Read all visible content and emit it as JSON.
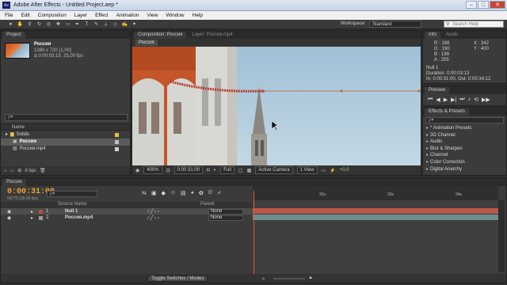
{
  "app": {
    "title": "Adobe After Effects - Untitled Project.aep *",
    "logo": "Ae"
  },
  "window_controls": {
    "minimize": "–",
    "maximize": "□",
    "close": "✕"
  },
  "menu": [
    "File",
    "Edit",
    "Composition",
    "Layer",
    "Effect",
    "Animation",
    "View",
    "Window",
    "Help"
  ],
  "toolbar": {
    "tools": [
      "selection-tool",
      "hand-tool",
      "zoom-tool",
      "rotate-tool",
      "camera-tool",
      "pan-behind-tool",
      "pen-tool",
      "type-tool",
      "brush-tool",
      "clone-stamp-tool",
      "eraser-tool",
      "roto-brush-tool",
      "puppet-tool"
    ],
    "workspace_label": "Workspace:",
    "workspace_value": "Standard",
    "search_placeholder": "Search Help"
  },
  "project": {
    "tab": "Project",
    "item_name": "Россия",
    "item_dims": "1280 x 720 (1,00)",
    "item_duration": "Δ 0:00:03:15, 25,00 fps",
    "search_placeholder": "ρ▾",
    "column_name": "Name",
    "items": [
      {
        "name": "Solids",
        "icon": "folder-icon",
        "color": "#e8c040",
        "selected": false
      },
      {
        "name": "Россия",
        "icon": "composition-icon",
        "color": "#c0c0c0",
        "selected": true
      },
      {
        "name": "Россия.mp4",
        "icon": "footage-icon",
        "color": "#d0d0d0",
        "selected": false
      }
    ],
    "bpc": "8 bpc"
  },
  "composition": {
    "tab": "Composition: Россия",
    "tab2": "Layer: Россия.mp4",
    "subtab": "Россия",
    "zoom": "400%",
    "timecode": "0:00:31:00",
    "resolution": "Full",
    "camera": "Active Camera",
    "views": "1 View",
    "exposure": "+0,0"
  },
  "info": {
    "tab": "Info",
    "tab2": "Audio",
    "r": "R : 168",
    "g": "G : 190",
    "b": "B : 199",
    "a": "A : 255",
    "x": "X : 342",
    "y": "Y : 400",
    "layer": "Null 1",
    "duration": "Duration: 0:00:03:13",
    "inout": "In: 0:00:31:00, Out: 0:00:34:12"
  },
  "preview": {
    "tab": "Preview"
  },
  "effects": {
    "tab": "Effects & Presets",
    "search_placeholder": "ρ▾",
    "items": [
      "* Animation Presets",
      "3D Channel",
      "Audio",
      "Blur & Sharpen",
      "Channel",
      "Color Correction",
      "Digital Anarchy"
    ]
  },
  "timeline": {
    "tab": "Россия",
    "current_time": "0:00:31:00",
    "frame_info": "00775 (25.00 fps)",
    "search_placeholder": "ρ▾",
    "columns": {
      "name": "Source Name",
      "parent": "Parent"
    },
    "layers": [
      {
        "num": "1",
        "name": "Null 1",
        "parent": "None",
        "color": "#c04a3a",
        "selected": true
      },
      {
        "num": "2",
        "name": "Россия.mp4",
        "parent": "None",
        "color": "#9a9a9a",
        "selected": false
      }
    ],
    "ruler_labels": [
      "32s",
      "33s",
      "34s"
    ],
    "toggle_label": "Toggle Switches / Modes",
    "colors": {
      "null_bar": "#b9584a",
      "video_bar": "#6f8e8e",
      "playhead": "#e05a2a",
      "timecode": "#f0a030"
    }
  }
}
